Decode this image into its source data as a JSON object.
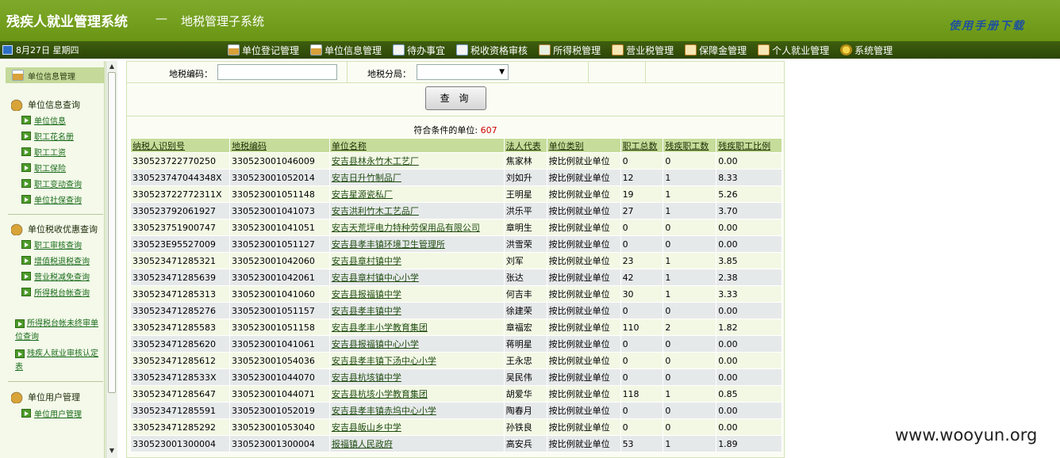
{
  "header": {
    "title": "残疾人就业管理系统",
    "dash": "—",
    "subtitle": "地税管理子系统",
    "manual_link": "使用手册下载"
  },
  "navbar": {
    "date": "8月27日 星期四",
    "menu": [
      {
        "label": "单位登记管理",
        "icon": "house-icon"
      },
      {
        "label": "单位信息管理",
        "icon": "house-icon"
      },
      {
        "label": "待办事宜",
        "icon": "document-icon"
      },
      {
        "label": "税收资格审核",
        "icon": "document-icon"
      },
      {
        "label": "所得税管理",
        "icon": "calculator-icon"
      },
      {
        "label": "营业税管理",
        "icon": "edit-icon"
      },
      {
        "label": "保障金管理",
        "icon": "edit-icon"
      },
      {
        "label": "个人就业管理",
        "icon": "edit-icon"
      },
      {
        "label": "系统管理",
        "icon": "gear-icon"
      }
    ]
  },
  "sidebar": {
    "top": "单位信息管理",
    "groups": [
      {
        "title": "单位信息查询",
        "items": [
          "单位信息",
          "职工花名册",
          "职工工资",
          "职工保险",
          "职工变动查询",
          "单位社保查询"
        ]
      },
      {
        "title": "单位税收优惠查询",
        "items": [
          "职工审核查询",
          "增值税退税查询",
          "营业税减免查询",
          "所得税台帐查询"
        ]
      },
      {
        "title": "",
        "items": [
          "所得税台帐未终审单位查询",
          "残疾人就业审核认定表"
        ]
      },
      {
        "title": "单位用户管理",
        "items": [
          "单位用户管理"
        ]
      }
    ]
  },
  "search": {
    "tax_code_label": "地税编码：",
    "tax_code_value": "",
    "tax_branch_label": "地税分局：",
    "tax_branch_value": "",
    "query_button": "查 询"
  },
  "results": {
    "count_label": "符合条件的单位: ",
    "count": "607",
    "columns": [
      "纳税人识别号",
      "地税编码",
      "单位名称",
      "法人代表",
      "单位类别",
      "职工总数",
      "残疾职工数",
      "残疾职工比例"
    ],
    "rows": [
      [
        "330523722770250",
        "330523001046009",
        "安吉县林永竹木工艺厂",
        "焦家林",
        "按比例就业单位",
        "0",
        "0",
        "0.00"
      ],
      [
        "330523747044348X",
        "330523001052014",
        "安吉日升竹制品厂",
        "刘如升",
        "按比例就业单位",
        "12",
        "1",
        "8.33"
      ],
      [
        "330523722772311X",
        "330523001051148",
        "安吉星源瓷私厂",
        "王明星",
        "按比例就业单位",
        "19",
        "1",
        "5.26"
      ],
      [
        "330523792061927",
        "330523001041073",
        "安吉洪利竹木工艺品厂",
        "洪乐平",
        "按比例就业单位",
        "27",
        "1",
        "3.70"
      ],
      [
        "330523751900747",
        "330523001041051",
        "安吉天荒坪电力特种劳保用品有限公司",
        "章明生",
        "按比例就业单位",
        "0",
        "0",
        "0.00"
      ],
      [
        "330523E95527009",
        "330523001051127",
        "安吉县孝丰镇环境卫生管理所",
        "洪雪荣",
        "按比例就业单位",
        "0",
        "0",
        "0.00"
      ],
      [
        "330523471285321",
        "330523001042060",
        "安吉县章村镇中学",
        "刘军",
        "按比例就业单位",
        "23",
        "1",
        "3.85"
      ],
      [
        "330523471285639",
        "330523001042061",
        "安吉县章村镇中心小学",
        "张达",
        "按比例就业单位",
        "42",
        "1",
        "2.38"
      ],
      [
        "330523471285313",
        "330523001041060",
        "安吉县报福镇中学",
        "何吉丰",
        "按比例就业单位",
        "30",
        "1",
        "3.33"
      ],
      [
        "330523471285276",
        "330523001051157",
        "安吉县孝丰镇中学",
        "徐建荣",
        "按比例就业单位",
        "0",
        "0",
        "0.00"
      ],
      [
        "330523471285583",
        "330523001051158",
        "安吉县孝丰小学教育集团",
        "章福宏",
        "按比例就业单位",
        "110",
        "2",
        "1.82"
      ],
      [
        "330523471285620",
        "330523001041061",
        "安吉县报福镇中心小学",
        "蒋明星",
        "按比例就业单位",
        "0",
        "0",
        "0.00"
      ],
      [
        "330523471285612",
        "330523001054036",
        "安吉县孝丰镇下汤中心小学",
        "王永忠",
        "按比例就业单位",
        "0",
        "0",
        "0.00"
      ],
      [
        "33052347128533X",
        "330523001044070",
        "安吉县杭垓镇中学",
        "吴民伟",
        "按比例就业单位",
        "0",
        "0",
        "0.00"
      ],
      [
        "330523471285647",
        "330523001044071",
        "安吉县杭垓小学教育集团",
        "胡爱华",
        "按比例就业单位",
        "118",
        "1",
        "0.85"
      ],
      [
        "330523471285591",
        "330523001052019",
        "安吉县孝丰镇赤坞中心小学",
        "陶春月",
        "按比例就业单位",
        "0",
        "0",
        "0.00"
      ],
      [
        "330523471285292",
        "330523001053040",
        "安吉县皈山乡中学",
        "孙铁良",
        "按比例就业单位",
        "0",
        "0",
        "0.00"
      ],
      [
        "330523001300004",
        "330523001300004",
        "报福镇人民政府",
        "高安兵",
        "按比例就业单位",
        "53",
        "1",
        "1.89"
      ]
    ]
  },
  "watermark": "www.wooyun.org"
}
